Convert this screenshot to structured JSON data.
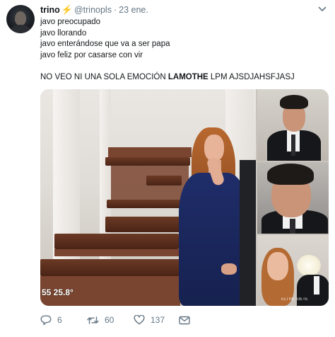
{
  "tweet": {
    "display_name": "trino",
    "badge_emoji": "⚡",
    "handle": "@trinopls",
    "separator": "·",
    "date": "23 ene.",
    "lines": [
      "javo preocupado",
      "javo llorando",
      "javo enterándose que va a ser papa",
      "javo feliz por casarse con vir"
    ],
    "last_line": {
      "before": "NO VEO NI UNA SOLA EMOCIÓN ",
      "bold": "LAMOTHE",
      "after": " LPM AJSDJAHSFJASJ"
    }
  },
  "media": {
    "overlay_text": "55  25.8°",
    "panel_watermark": "ELTRE SIETE"
  },
  "actions": {
    "reply": {
      "icon": "reply-icon",
      "count": "6"
    },
    "retweet": {
      "icon": "retweet-icon",
      "count": "60"
    },
    "like": {
      "icon": "heart-icon",
      "count": "137"
    },
    "dm": {
      "icon": "envelope-icon"
    }
  },
  "colors": {
    "text_primary": "#14171a",
    "text_secondary": "#657786",
    "bolt": "#f5b400"
  }
}
